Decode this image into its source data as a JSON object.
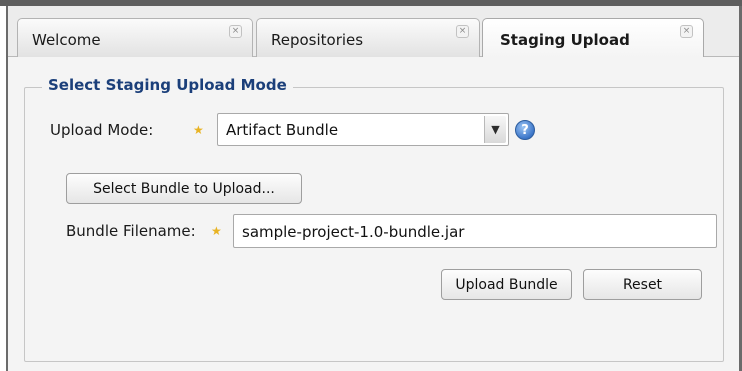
{
  "tabs": [
    {
      "label": "Welcome",
      "active": false
    },
    {
      "label": "Repositories",
      "active": false
    },
    {
      "label": "Staging Upload",
      "active": true
    }
  ],
  "tab_close_glyph": "×",
  "form": {
    "legend": "Select Staging Upload Mode",
    "upload_mode_label": "Upload Mode:",
    "upload_mode_value": "Artifact Bundle",
    "select_bundle_button": "Select Bundle to Upload...",
    "bundle_filename_label": "Bundle Filename:",
    "bundle_filename_value": "sample-project-1.0-bundle.jar",
    "upload_button": "Upload Bundle",
    "reset_button": "Reset"
  },
  "icons": {
    "required": "star-icon",
    "help": "help-icon",
    "dropdown": "chevron-down-icon",
    "close": "close-icon"
  },
  "colors": {
    "legend_text": "#1b3f7a",
    "required_star": "#e8b323",
    "help_icon": "#3c76c9"
  }
}
